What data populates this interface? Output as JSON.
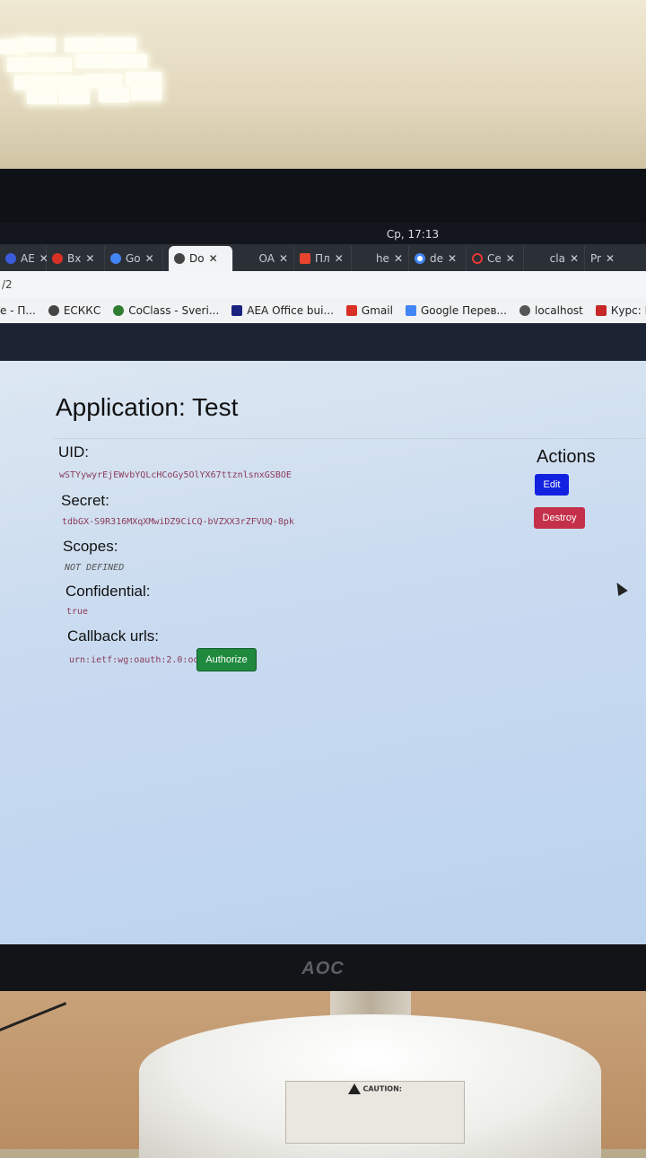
{
  "system": {
    "clock": "Ср, 17:13"
  },
  "tabs": [
    {
      "label": "AE",
      "color": "#3b5bdb",
      "active": false
    },
    {
      "label": "Вх",
      "color": "#d93025",
      "active": false
    },
    {
      "label": "Go",
      "color": "#4285f4",
      "active": false
    },
    {
      "label": "Do",
      "color": "#444444",
      "active": true
    },
    {
      "label": "OA",
      "color": "#2b2f36",
      "active": false
    },
    {
      "label": "Пл",
      "color": "#e8442e",
      "active": false
    },
    {
      "label": "he",
      "color": "#2b2f36",
      "active": false
    },
    {
      "label": "de",
      "color": "#ffffff",
      "active": false
    },
    {
      "label": "Ce",
      "color": "#e53935",
      "active": false
    },
    {
      "label": "cla",
      "color": "#2b2f36",
      "active": false
    },
    {
      "label": "Pr",
      "color": "#2b2f36",
      "active": false
    }
  ],
  "address_bar": {
    "url_fragment": "/2"
  },
  "bookmarks": [
    {
      "label": "е - П...",
      "color": "#888888"
    },
    {
      "label": "ЕСККС",
      "color": "#444444"
    },
    {
      "label": "CoClass - Sveri...",
      "color": "#2e7d32"
    },
    {
      "label": "AEA Office bui...",
      "color": "#1a237e"
    },
    {
      "label": "Gmail",
      "color": "#d93025"
    },
    {
      "label": "Google Перев...",
      "color": "#4285f4"
    },
    {
      "label": "localhost",
      "color": "#555555"
    },
    {
      "label": "Курс: Revit",
      "color": "#c62828"
    }
  ],
  "app": {
    "title": "Application: Test",
    "uid_label": "UID:",
    "uid_value": "wSTYywyrEjEWvbYQLcHCoGy5OlYX67ttznlsnxGSBOE",
    "secret_label": "Secret:",
    "secret_value": "tdbGX-S9R316MXqXMwiDZ9CiCQ-bVZXX3rZFVUQ-8pk",
    "scopes_label": "Scopes:",
    "scopes_value": "NOT DEFINED",
    "confidential_label": "Confidential:",
    "confidential_value": "true",
    "callback_label": "Callback urls:",
    "callback_value": "urn:ietf:wg:oauth:2.0:oob",
    "authorize_label": "Authorize",
    "actions_label": "Actions",
    "edit_label": "Edit",
    "destroy_label": "Destroy"
  },
  "monitor": {
    "brand": "AOC",
    "caution_title": "CAUTION:"
  }
}
